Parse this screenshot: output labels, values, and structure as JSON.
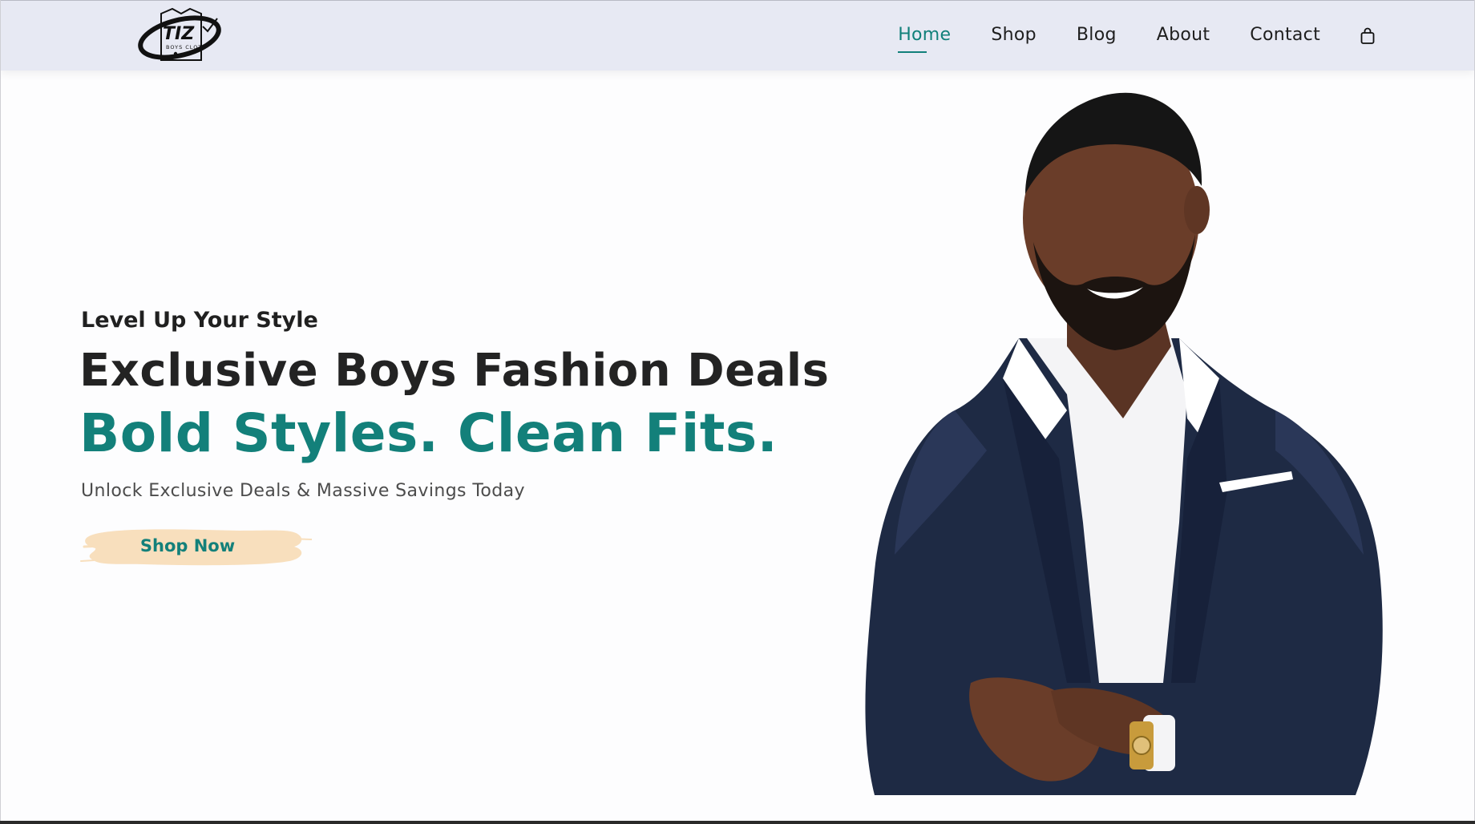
{
  "brand": {
    "logo_letters": "TIZ",
    "logo_subtext": "BOYS CLOTH"
  },
  "nav": {
    "items": [
      {
        "label": "Home",
        "active": true
      },
      {
        "label": "Shop",
        "active": false
      },
      {
        "label": "Blog",
        "active": false
      },
      {
        "label": "About",
        "active": false
      },
      {
        "label": "Contact",
        "active": false
      }
    ],
    "cart_icon": "shopping-bag-icon"
  },
  "hero": {
    "eyebrow": "Level Up Your Style",
    "headline": "Exclusive Boys Fashion Deals",
    "subheadline": "Bold Styles. Clean Fits.",
    "tagline": "Unlock Exclusive Deals & Massive Savings Today",
    "cta_label": "Shop Now"
  },
  "colors": {
    "accent": "#13807a",
    "header_bg": "#e7e9f3",
    "cta_brush": "#f8dfbd",
    "text_dark": "#232323"
  }
}
